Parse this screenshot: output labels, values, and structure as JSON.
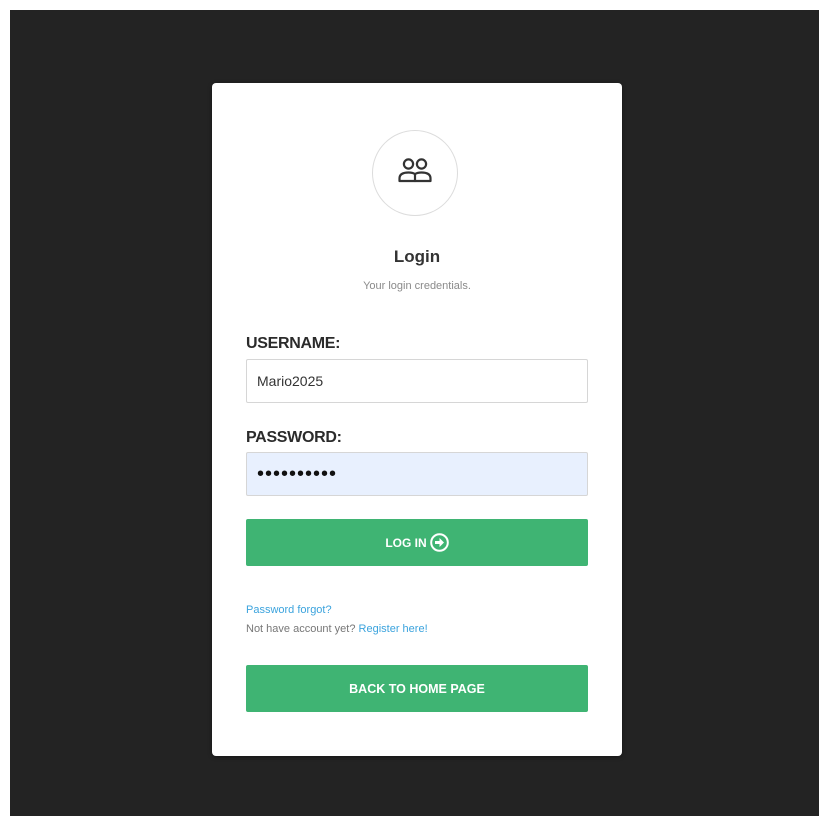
{
  "colors": {
    "page_background": "#232323",
    "card_background": "#ffffff",
    "primary_button": "#3fb473",
    "link": "#3ba3dd",
    "autofill_field": "#e8f0fe"
  },
  "header": {
    "icon": "users-icon",
    "title": "Login",
    "subtitle": "Your login credentials."
  },
  "form": {
    "username_label": "USERNAME:",
    "username_value": "Mario2025",
    "password_label": "PASSWORD:",
    "password_value": "••••••••••",
    "login_button_label": "LOG IN",
    "login_button_icon": "arrow-right-circle-icon"
  },
  "links": {
    "forgot_password": "Password forgot?",
    "no_account_text": "Not have account yet?",
    "register": "Register here!"
  },
  "footer": {
    "back_home_label": "BACK TO HOME PAGE"
  }
}
